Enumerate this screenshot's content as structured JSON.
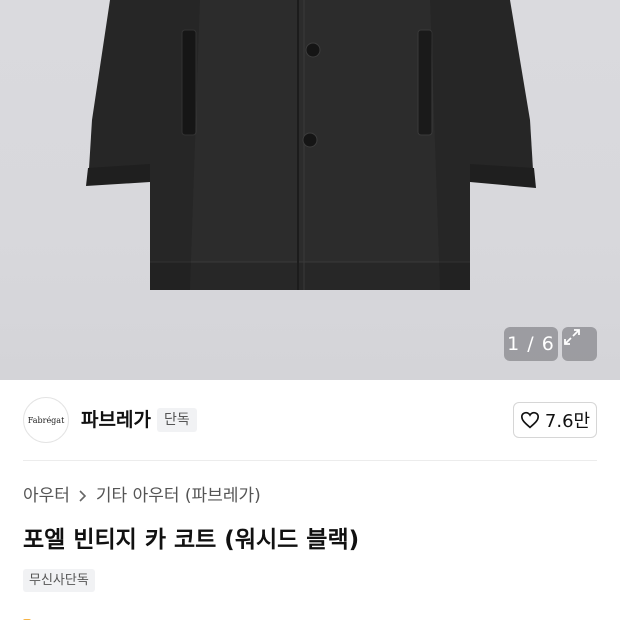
{
  "gallery": {
    "counter": "1 / 6",
    "expand_icon": "expand-icon"
  },
  "brand": {
    "logo_text": "Fabrégat",
    "name": "파브레가",
    "badge": "단독",
    "like_icon": "heart-icon",
    "like_count": "7.6만"
  },
  "breadcrumb": {
    "items": [
      "아우터",
      "기타 아우터 (파브레가)"
    ],
    "separator_icon": "chevron-right-icon"
  },
  "product": {
    "title": "포엘 빈티지 카 코트 (워시드 블랙)",
    "tag": "무신사단독"
  },
  "colors": {
    "image_bg": "#d8d8dc",
    "coat": "#2b2b2b",
    "badge_bg": "#f1f2f4",
    "text_primary": "#111111",
    "text_secondary": "#555555"
  }
}
